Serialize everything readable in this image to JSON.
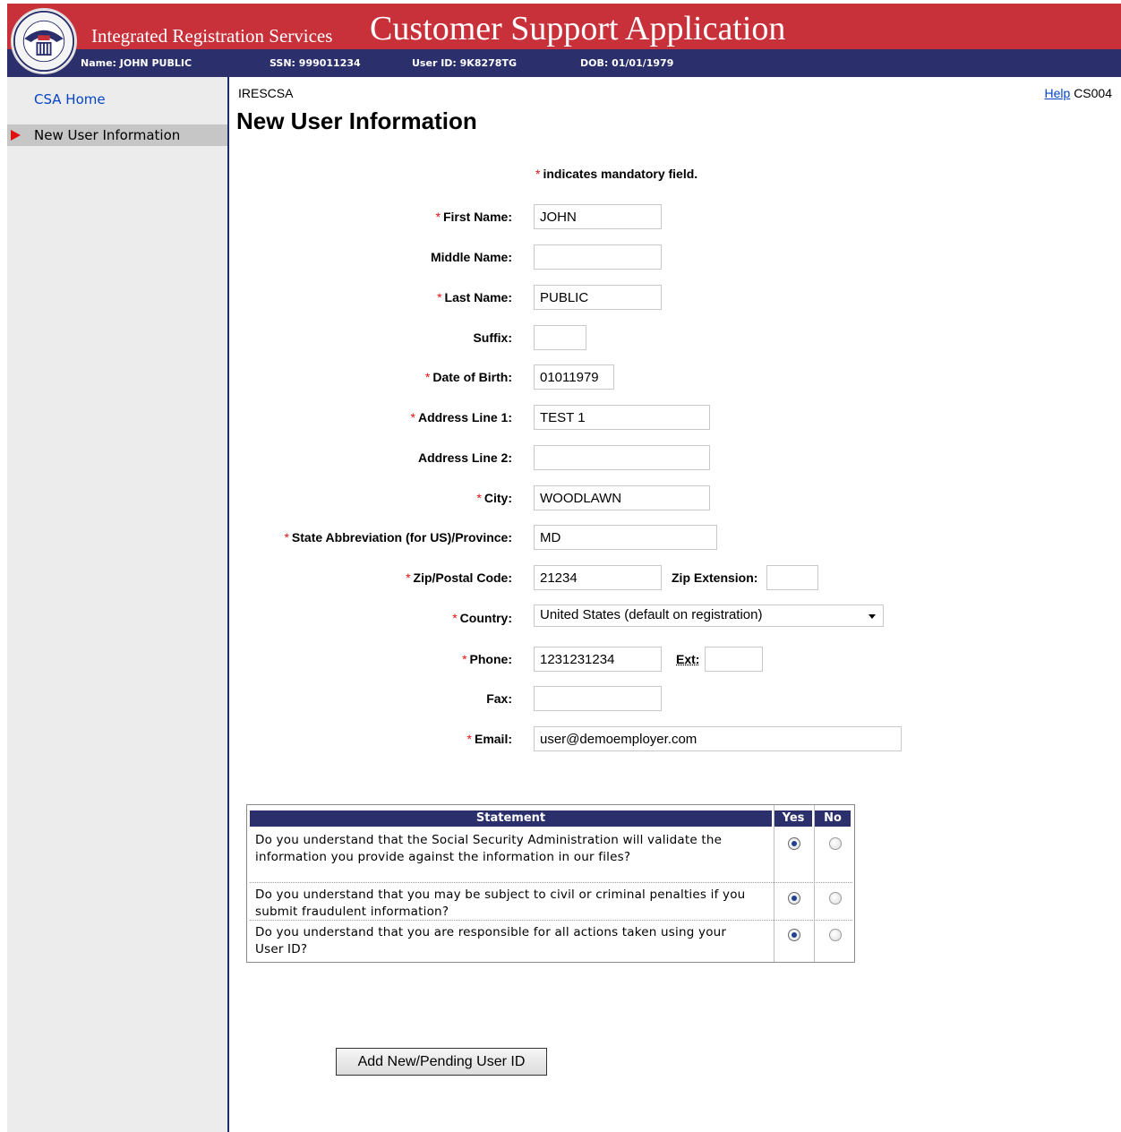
{
  "header": {
    "system_name": "Integrated Registration Services",
    "app_title": "Customer Support Application",
    "seal_text": "SOCIAL SECURITY ADMINISTRATION USA",
    "name": "Name: JOHN PUBLIC",
    "ssn": "SSN: 999011234",
    "user_id": "User ID: 9K8278TG",
    "dob": "DOB: 01/01/1979"
  },
  "sidebar": {
    "home": "CSA Home",
    "active_item": "New User Information"
  },
  "main": {
    "breadcrumb": "IRESCSA",
    "help_link": "Help",
    "screen_code": "CS004",
    "title": "New User Information",
    "mandatory_note": "indicates mandatory field.",
    "required_marker": "*"
  },
  "form": {
    "first_name": {
      "label": "First Name:",
      "value": "JOHN"
    },
    "middle_name": {
      "label": "Middle Name:",
      "value": ""
    },
    "last_name": {
      "label": "Last Name:",
      "value": "PUBLIC"
    },
    "suffix": {
      "label": "Suffix:",
      "value": ""
    },
    "dob": {
      "label": "Date of Birth:",
      "value": "01011979"
    },
    "address1": {
      "label": "Address Line 1:",
      "value": "TEST 1"
    },
    "address2": {
      "label": "Address Line 2:",
      "value": ""
    },
    "city": {
      "label": "City:",
      "value": "WOODLAWN"
    },
    "state": {
      "label": "State Abbreviation (for US)/Province:",
      "value": "MD"
    },
    "zip": {
      "label": "Zip/Postal Code:",
      "value": "21234"
    },
    "zip_ext": {
      "label": "Zip Extension:",
      "value": ""
    },
    "country": {
      "label": "Country:",
      "value": "United States (default on registration)"
    },
    "phone": {
      "label": "Phone:",
      "value": "1231231234"
    },
    "phone_ext": {
      "label": "Ext:",
      "value": ""
    },
    "fax": {
      "label": "Fax:",
      "value": ""
    },
    "email": {
      "label": "Email:",
      "value": "user@demoemployer.com"
    }
  },
  "statements": {
    "headers": {
      "statement": "Statement",
      "yes": "Yes",
      "no": "No"
    },
    "rows": [
      {
        "text": "Do you understand that the Social Security Administration will validate the information you provide against the information in our files?",
        "answer": "Yes"
      },
      {
        "text": "Do you understand that you may be subject to civil or criminal penalties if you submit fraudulent information?",
        "answer": "Yes"
      },
      {
        "text": "Do you understand that you are responsible for all actions taken using your User ID?",
        "answer": "Yes"
      }
    ]
  },
  "submit_label": "Add New/Pending User ID",
  "colors": {
    "header_red": "#c8313a",
    "header_navy": "#2b2f6b",
    "required_star": "#e01010",
    "link_blue": "#0645c8"
  }
}
